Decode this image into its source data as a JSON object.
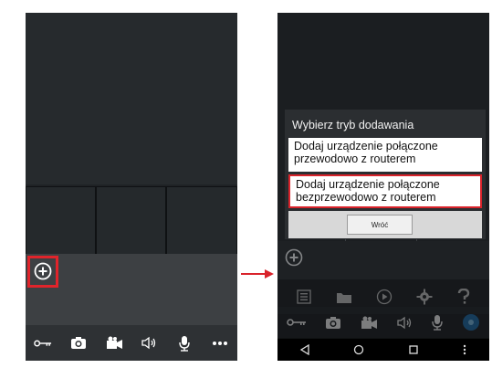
{
  "left_screen": {
    "add_label": "+",
    "toolbar_icons": [
      "key-icon",
      "camera-icon",
      "video-camera-icon",
      "speaker-icon",
      "microphone-icon",
      "more-icon"
    ],
    "highlight_color": "#e0242b"
  },
  "arrow_color": "#d9232b",
  "right_screen": {
    "dialog": {
      "title": "Wybierz tryb dodawania",
      "option_wired": "Dodaj urządzenie połączone przewodowo z routerem",
      "option_wireless": "Dodaj urządzenie połączone bezprzewodowo z routerem",
      "back_button": "Wróć"
    },
    "menu_icons": [
      "list-icon",
      "folder-icon",
      "playback-icon",
      "settings-icon",
      "help-icon"
    ],
    "toolbar_icons": [
      "key-icon",
      "camera-icon",
      "video-camera-icon",
      "speaker-icon",
      "microphone-icon",
      "ptz-icon"
    ],
    "nav_icons": [
      "back-icon",
      "home-icon",
      "recents-icon",
      "menu-icon"
    ]
  }
}
